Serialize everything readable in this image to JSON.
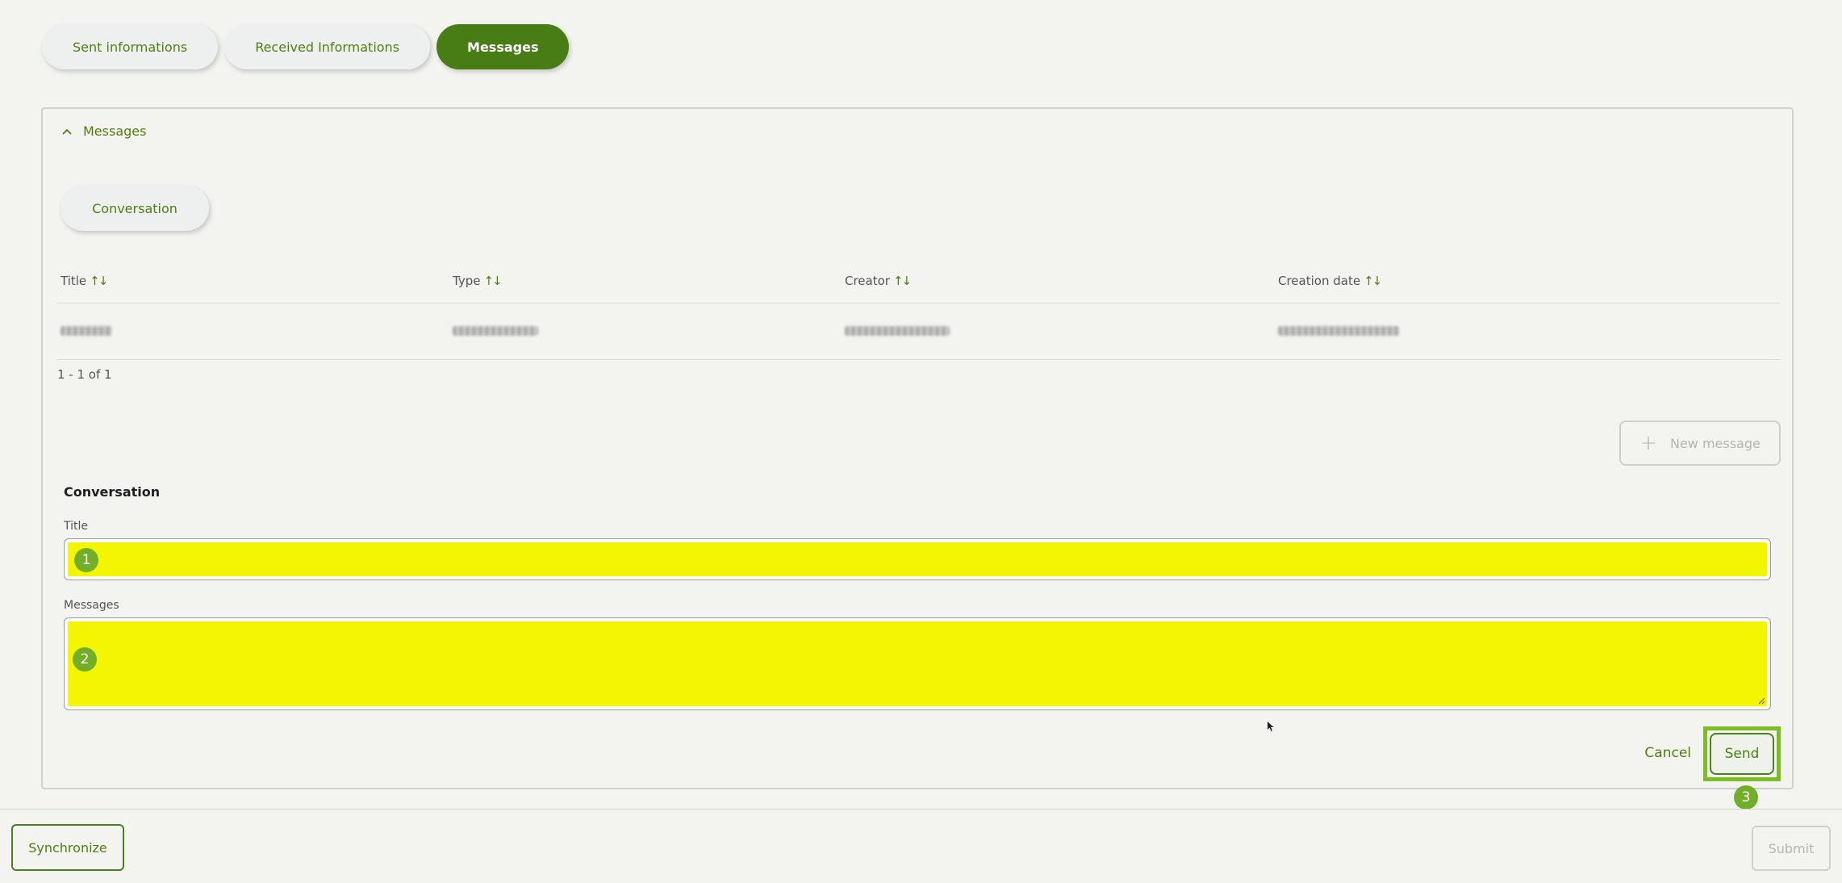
{
  "tabs": [
    {
      "label": "Sent informations",
      "active": false
    },
    {
      "label": "Received Informations",
      "active": false
    },
    {
      "label": "Messages",
      "active": true
    }
  ],
  "section": {
    "title": "Messages",
    "icon": "chevron-up-icon"
  },
  "conversation_tab": {
    "label": "Conversation"
  },
  "table": {
    "columns": [
      "Title",
      "Type",
      "Creator",
      "Creation date"
    ],
    "sort_icon": "sort-arrows-icon",
    "rows": [
      {
        "redacted": true
      }
    ]
  },
  "pagination": {
    "text": "1 - 1 of 1"
  },
  "new_message": {
    "label": "New message",
    "icon": "plus-icon"
  },
  "form": {
    "heading": "Conversation",
    "title_label": "Title",
    "title_value": "",
    "title_badge": "1",
    "messages_label": "Messages",
    "messages_value": "",
    "messages_badge": "2"
  },
  "actions": {
    "cancel": "Cancel",
    "send": "Send",
    "send_badge": "3"
  },
  "footer": {
    "synchronize": "Synchronize",
    "submit": "Submit"
  },
  "colors": {
    "accent": "#477d14",
    "highlight": "#f4f601",
    "badge": "#72af29",
    "background": "#f3f3ef"
  }
}
